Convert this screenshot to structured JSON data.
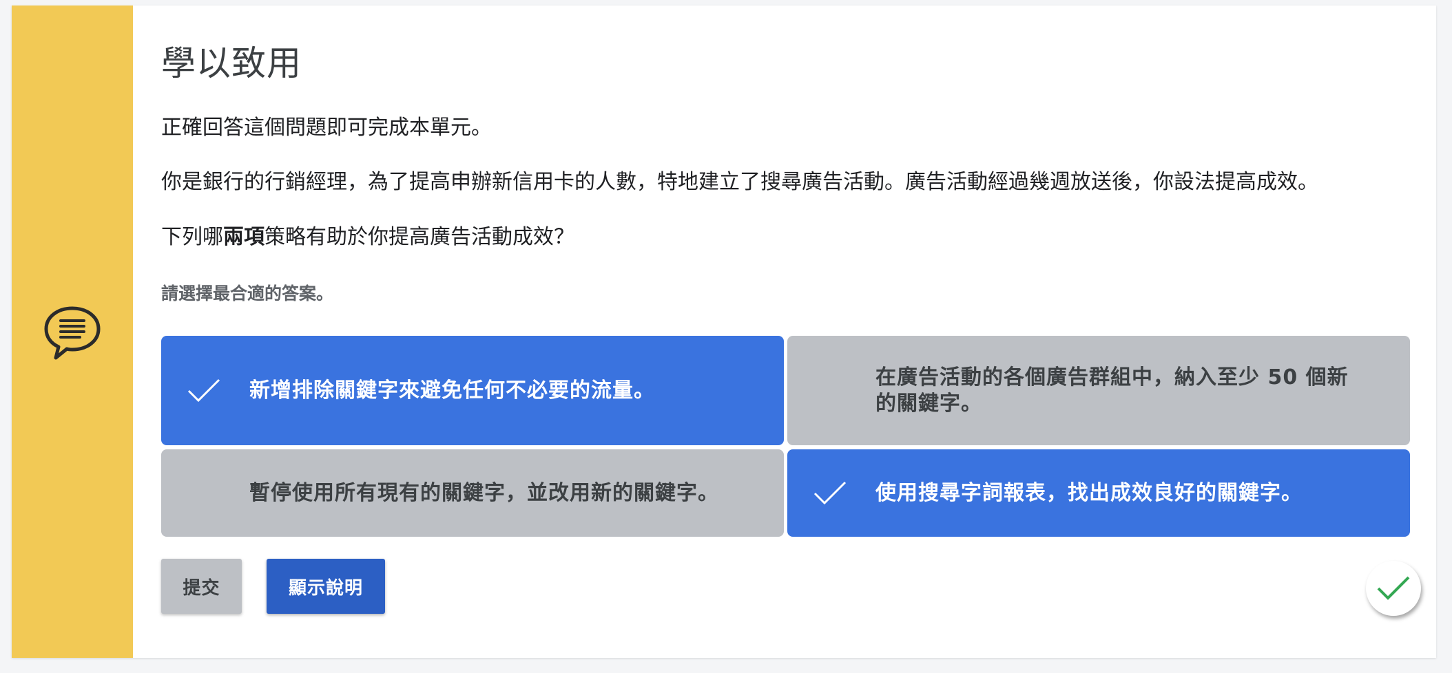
{
  "colors": {
    "accent_bar": "#f2c955",
    "selected_option": "#3a73df",
    "unselected_option": "#bdc0c5",
    "explain_button": "#2c5fc4",
    "complete_check": "#34a853"
  },
  "sidebar": {
    "icon": "chat-bubble-icon"
  },
  "question": {
    "title": "學以致用",
    "intro": "正確回答這個問題即可完成本單元。",
    "scenario": "你是銀行的行銷經理，為了提高申辦新信用卡的人數，特地建立了搜尋廣告活動。廣告活動經過幾週放送後，你設法提高成效。",
    "prompt_before": "下列哪",
    "prompt_bold": "兩項",
    "prompt_after": "策略有助於你提高廣告活動成效？",
    "hint": "請選擇最合適的答案。"
  },
  "options": [
    {
      "label": "新增排除關鍵字來避免任何不必要的流量。",
      "selected": true,
      "icon": "checkmark-icon"
    },
    {
      "label": "在廣告活動的各個廣告群組中，納入至少 50 個新的關鍵字。",
      "selected": false
    },
    {
      "label": "暫停使用所有現有的關鍵字，並改用新的關鍵字。",
      "selected": false
    },
    {
      "label": "使用搜尋字詞報表，找出成效良好的關鍵字。",
      "selected": true,
      "icon": "checkmark-icon"
    }
  ],
  "actions": {
    "submit_label": "提交",
    "explain_label": "顯示說明"
  },
  "status": {
    "icon": "completed-checkmark-icon"
  }
}
